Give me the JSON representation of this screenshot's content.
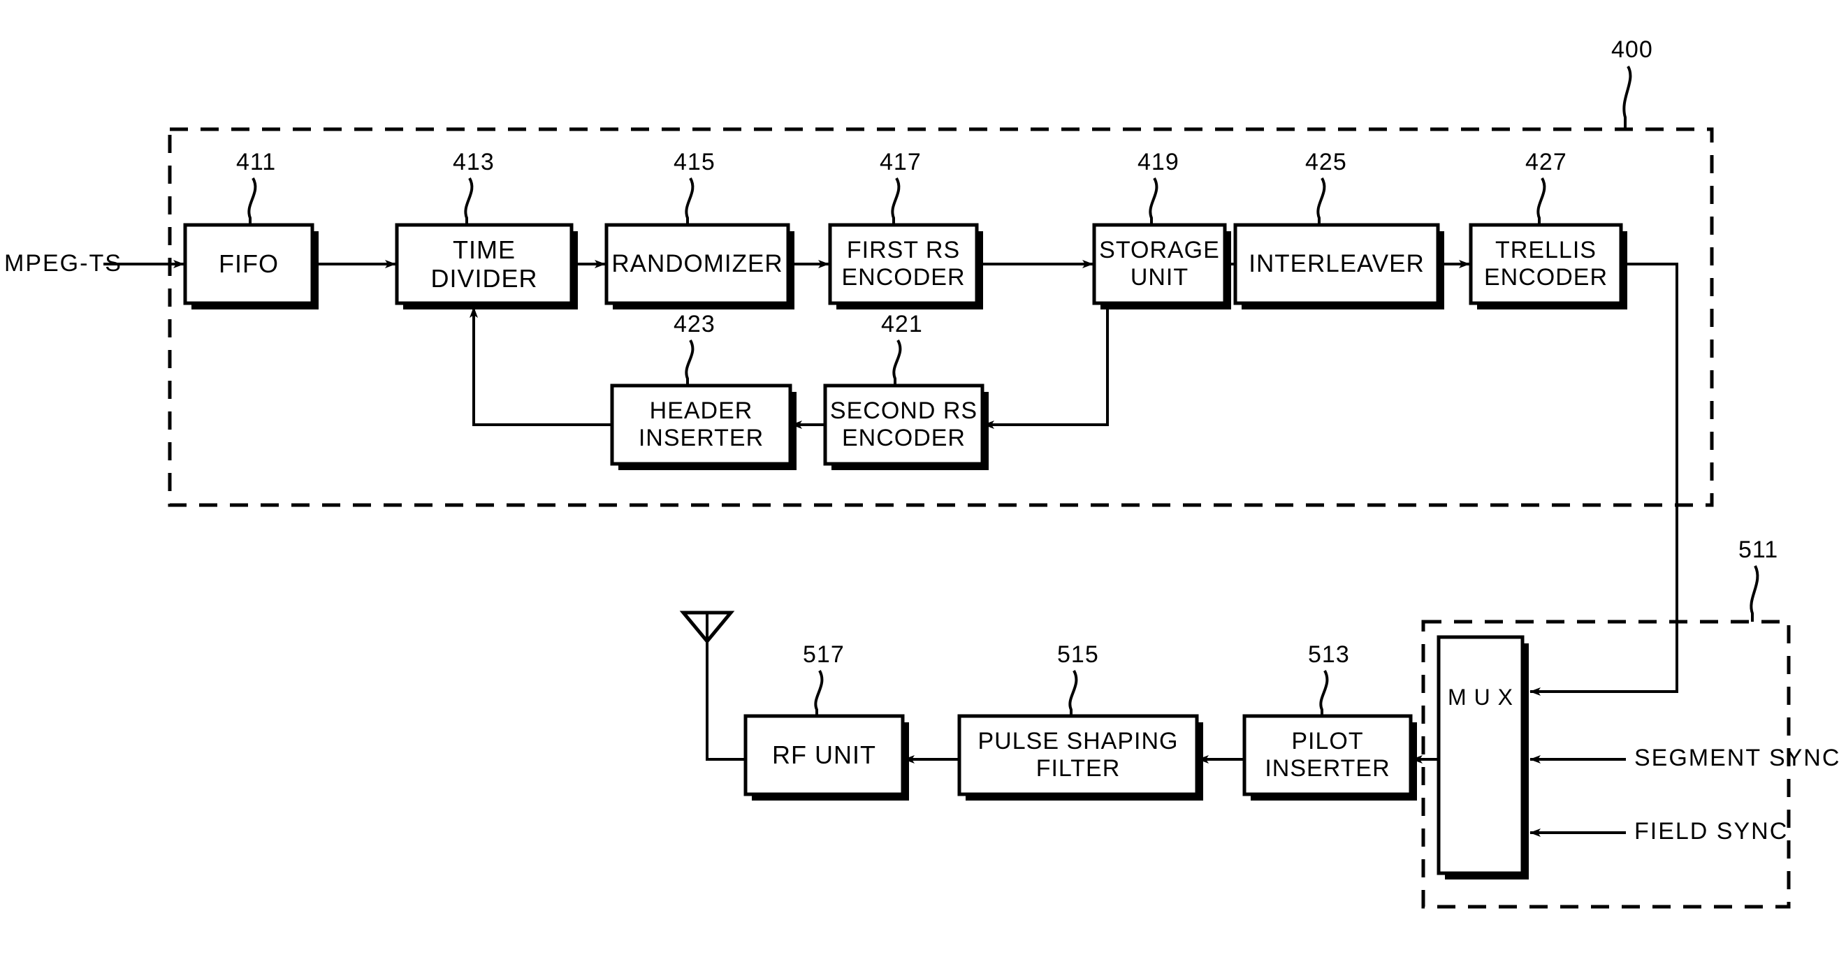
{
  "figure": {
    "type": "patent-block-diagram",
    "input_signal_label": "MPEG-TS",
    "group_400_ref": "400",
    "group_511_ref": "511"
  },
  "blocks": {
    "fifo": {
      "label": "FIFO",
      "ref": "411"
    },
    "time_divider": {
      "label": "TIME\nDIVIDER",
      "ref": "413"
    },
    "randomizer": {
      "label": "RANDOMIZER",
      "ref": "415"
    },
    "first_rs": {
      "label": "FIRST RS\nENCODER",
      "ref": "417"
    },
    "storage_unit": {
      "label": "STORAGE\nUNIT",
      "ref": "419"
    },
    "interleaver": {
      "label": "INTERLEAVER",
      "ref": "425"
    },
    "trellis_encoder": {
      "label": "TRELLIS\nENCODER",
      "ref": "427"
    },
    "header_inserter": {
      "label": "HEADER\nINSERTER",
      "ref": "423"
    },
    "second_rs": {
      "label": "SECOND RS\nENCODER",
      "ref": "421"
    },
    "mux": {
      "label": "M\nU\nX",
      "ref": "511"
    },
    "pilot_inserter": {
      "label": "PILOT\nINSERTER",
      "ref": "513"
    },
    "pulse_shaping": {
      "label": "PULSE SHAPING\nFILTER",
      "ref": "515"
    },
    "rf_unit": {
      "label": "RF UNIT",
      "ref": "517"
    }
  },
  "signals": {
    "segment_sync": "SEGMENT SYNC",
    "field_sync": "FIELD SYNC"
  },
  "colors": {
    "line": "#000000",
    "background": "#ffffff"
  }
}
